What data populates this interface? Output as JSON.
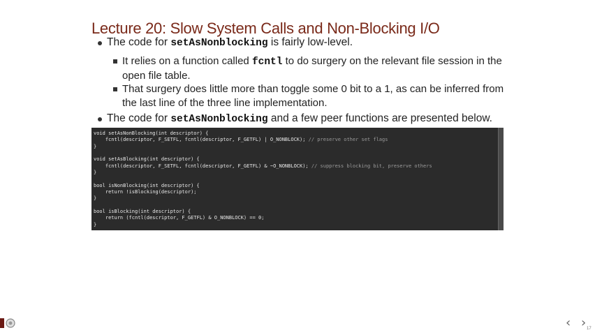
{
  "title": "Lecture 20: Slow System Calls and Non-Blocking I/O",
  "bullet1": {
    "pre": "The code for ",
    "code": "setAsNonblocking",
    "post": " is fairly low-level."
  },
  "sub1": {
    "pre": "It relies on a function called ",
    "code": "fcntl",
    "post": " to do surgery on the relevant file session in the open file table."
  },
  "sub2": {
    "text": "That surgery does little more than toggle some 0 bit to a 1, as can be inferred from the last line of the three line implementation."
  },
  "bullet2": {
    "pre": "The code for ",
    "code": "setAsNonblocking",
    "post": " and a few peer functions are presented below."
  },
  "code_lines": [
    "void setAsNonBlocking(int descriptor) {",
    "    fcntl(descriptor, F_SETFL, fcntl(descriptor, F_GETFL) | O_NONBLOCK); ",
    "}",
    "",
    "void setAsBlocking(int descriptor) {",
    "    fcntl(descriptor, F_SETFL, fcntl(descriptor, F_GETFL) & ~O_NONBLOCK); ",
    "}",
    "",
    "bool isNonBlocking(int descriptor) {",
    "    return !isBlocking(descriptor);",
    "}",
    "",
    "bool isBlocking(int descriptor) {",
    "    return (fcntl(descriptor, F_GETFL) & O_NONBLOCK) == 0;",
    "}"
  ],
  "comments": {
    "line1": "// preserve other set flags",
    "line5": "// suppress blocking bit, preserve others"
  },
  "nav": {
    "prev": "‹",
    "next": "›"
  },
  "page_number": "17",
  "colors": {
    "title": "#7a2a1a",
    "code_bg": "#2b2b2b"
  }
}
